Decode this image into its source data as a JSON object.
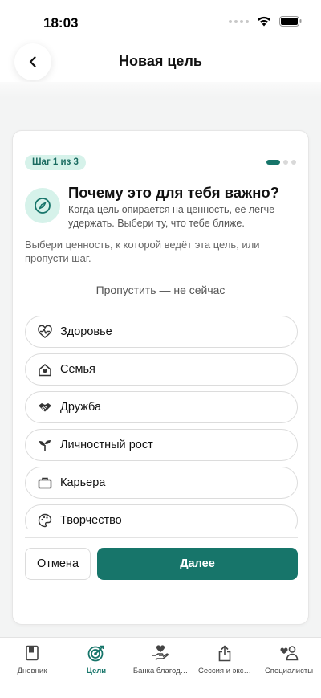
{
  "status_bar": {
    "time": "18:03"
  },
  "header": {
    "title": "Новая цель"
  },
  "step": {
    "badge": "Шаг 1 из 3",
    "total": 3,
    "current": 1
  },
  "question": {
    "title": "Почему это для тебя важно?",
    "subtitle": "Когда цель опирается на ценность, её легче удержать. Выбери ту, что тебе ближе.",
    "hint": "Выбери ценность, к которой ведёт эта цель, или пропусти шаг.",
    "skip_label": "Пропустить — не сейчас"
  },
  "values": [
    {
      "label": "Здоровье",
      "icon": "heart-pulse-icon"
    },
    {
      "label": "Семья",
      "icon": "home-heart-icon"
    },
    {
      "label": "Дружба",
      "icon": "handshake-icon"
    },
    {
      "label": "Личностный рост",
      "icon": "sprout-icon"
    },
    {
      "label": "Карьера",
      "icon": "briefcase-icon"
    },
    {
      "label": "Творчество",
      "icon": "palette-icon"
    }
  ],
  "actions": {
    "cancel_label": "Отмена",
    "next_label": "Далее"
  },
  "tab_bar": [
    {
      "label": "Дневник",
      "icon": "book-icon",
      "active": false
    },
    {
      "label": "Цели",
      "icon": "target-icon",
      "active": true
    },
    {
      "label": "Банка благод…",
      "icon": "gratitude-jar-icon",
      "active": false
    },
    {
      "label": "Сессия и экс…",
      "icon": "share-icon",
      "active": false
    },
    {
      "label": "Специалисты",
      "icon": "specialists-icon",
      "active": false
    }
  ],
  "colors": {
    "accent": "#17756a",
    "accent_light": "#d6f2ea"
  }
}
